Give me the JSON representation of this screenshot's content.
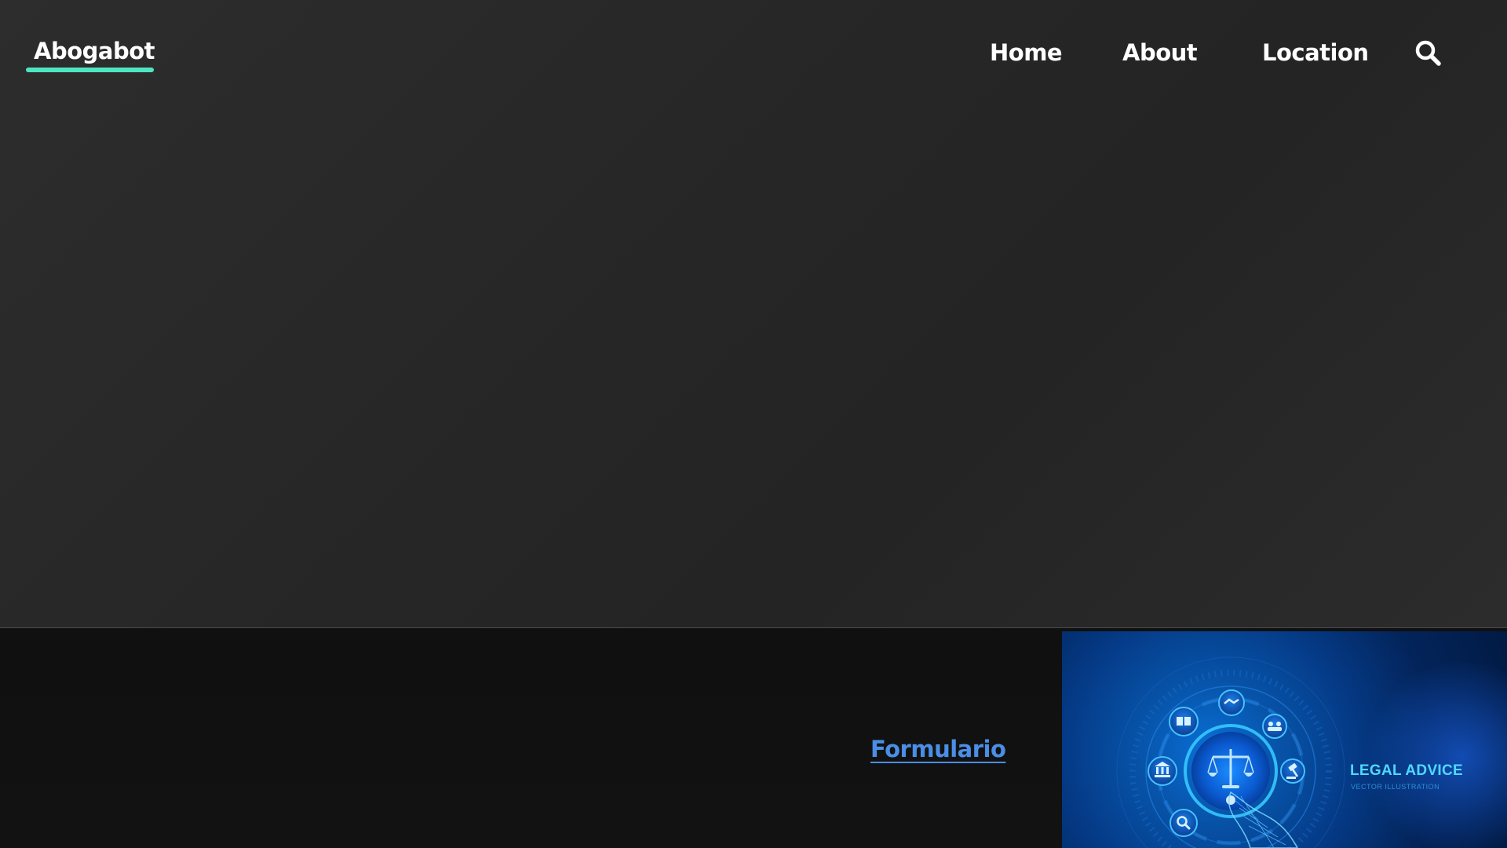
{
  "nav": {
    "brand": "Abogabot",
    "links": [
      {
        "label": "Home"
      },
      {
        "label": "About"
      },
      {
        "label": "Location"
      }
    ],
    "search_icon": "search-icon"
  },
  "footer": {
    "form_link": "Formulario",
    "banner": {
      "title": "LEGAL ADVICE",
      "subtitle": "VECTOR ILLUSTRATION",
      "icons": [
        "scales-icon",
        "book-icon",
        "handshake-icon",
        "people-icon",
        "courthouse-icon",
        "gavel-icon",
        "magnifier-icon",
        "hand-icon"
      ]
    }
  },
  "colors": {
    "accent": "#4ee6c0",
    "link": "#4a8ee6",
    "background_top": "#2a2a2a",
    "background_bottom": "#111111",
    "banner_cyan": "#4fd8ff"
  }
}
